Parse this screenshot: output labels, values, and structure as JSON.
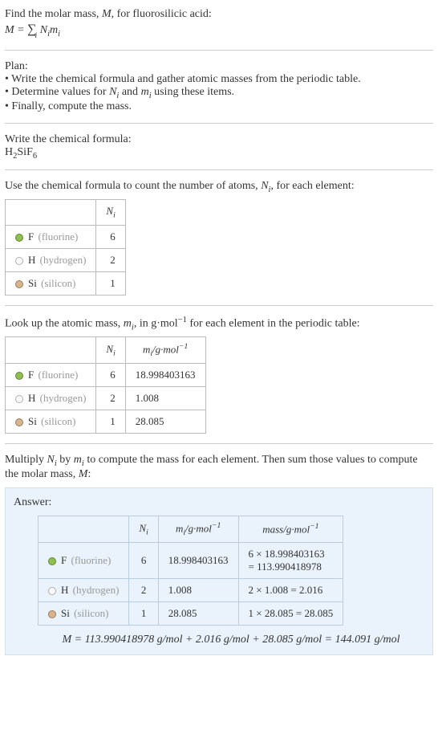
{
  "intro": {
    "line1_pre": "Find the molar mass, ",
    "M": "M",
    "line1_post": ", for fluorosilicic acid:",
    "eq_lhs": "M = ",
    "sigma": "∑",
    "sigma_sub": "i",
    "Ni": "N",
    "Ni_sub": "i",
    "mi": "m",
    "mi_sub": "i"
  },
  "plan": {
    "title": "Plan:",
    "b1_pre": "• Write the chemical formula and gather atomic masses from the periodic table.",
    "b2_pre": "• Determine values for ",
    "b2_N": "N",
    "b2_Ni": "i",
    "b2_and": " and ",
    "b2_m": "m",
    "b2_mi": "i",
    "b2_post": " using these items.",
    "b3": "• Finally, compute the mass."
  },
  "chem": {
    "title": "Write the chemical formula:",
    "H": "H",
    "H2": "2",
    "Si": "Si",
    "F": "F",
    "F6": "6"
  },
  "count": {
    "text_pre": "Use the chemical formula to count the number of atoms, ",
    "N": "N",
    "Ni": "i",
    "text_post": ", for each element:",
    "header_N": "N",
    "header_Ni": "i",
    "rows": [
      {
        "sym": "F",
        "name": "(fluorine)",
        "n": "6"
      },
      {
        "sym": "H",
        "name": "(hydrogen)",
        "n": "2"
      },
      {
        "sym": "Si",
        "name": "(silicon)",
        "n": "1"
      }
    ]
  },
  "mass": {
    "text_pre": "Look up the atomic mass, ",
    "m": "m",
    "mi": "i",
    "text_mid": ", in g·mol",
    "exp": "−1",
    "text_post": " for each element in the periodic table:",
    "header_N": "N",
    "header_Ni": "i",
    "header_m_pre": "m",
    "header_mi": "i",
    "header_unit": "/g·mol",
    "header_exp": "−1",
    "rows": [
      {
        "sym": "F",
        "name": "(fluorine)",
        "n": "6",
        "m": "18.998403163"
      },
      {
        "sym": "H",
        "name": "(hydrogen)",
        "n": "2",
        "m": "1.008"
      },
      {
        "sym": "Si",
        "name": "(silicon)",
        "n": "1",
        "m": "28.085"
      }
    ]
  },
  "multiply": {
    "pre": "Multiply ",
    "N": "N",
    "Ni": "i",
    "by": " by ",
    "m": "m",
    "mi": "i",
    "post1": " to compute the mass for each element. Then sum those values to compute the molar mass, ",
    "M": "M",
    "post2": ":"
  },
  "answer": {
    "title": "Answer:",
    "header_N": "N",
    "header_Ni": "i",
    "header_m": "m",
    "header_mi": "i",
    "header_m_unit": "/g·mol",
    "header_m_exp": "−1",
    "header_mass": "mass/g·mol",
    "header_mass_exp": "−1",
    "rows": [
      {
        "sym": "F",
        "name": "(fluorine)",
        "n": "6",
        "m": "18.998403163",
        "calc_a": "6 × 18.998403163",
        "calc_b": "= 113.990418978"
      },
      {
        "sym": "H",
        "name": "(hydrogen)",
        "n": "2",
        "m": "1.008",
        "calc": "2 × 1.008 = 2.016"
      },
      {
        "sym": "Si",
        "name": "(silicon)",
        "n": "1",
        "m": "28.085",
        "calc": "1 × 28.085 = 28.085"
      }
    ],
    "final_M": "M",
    "final_eq": " = 113.990418978 g/mol + 2.016 g/mol + 28.085 g/mol = 144.091 g/mol"
  }
}
